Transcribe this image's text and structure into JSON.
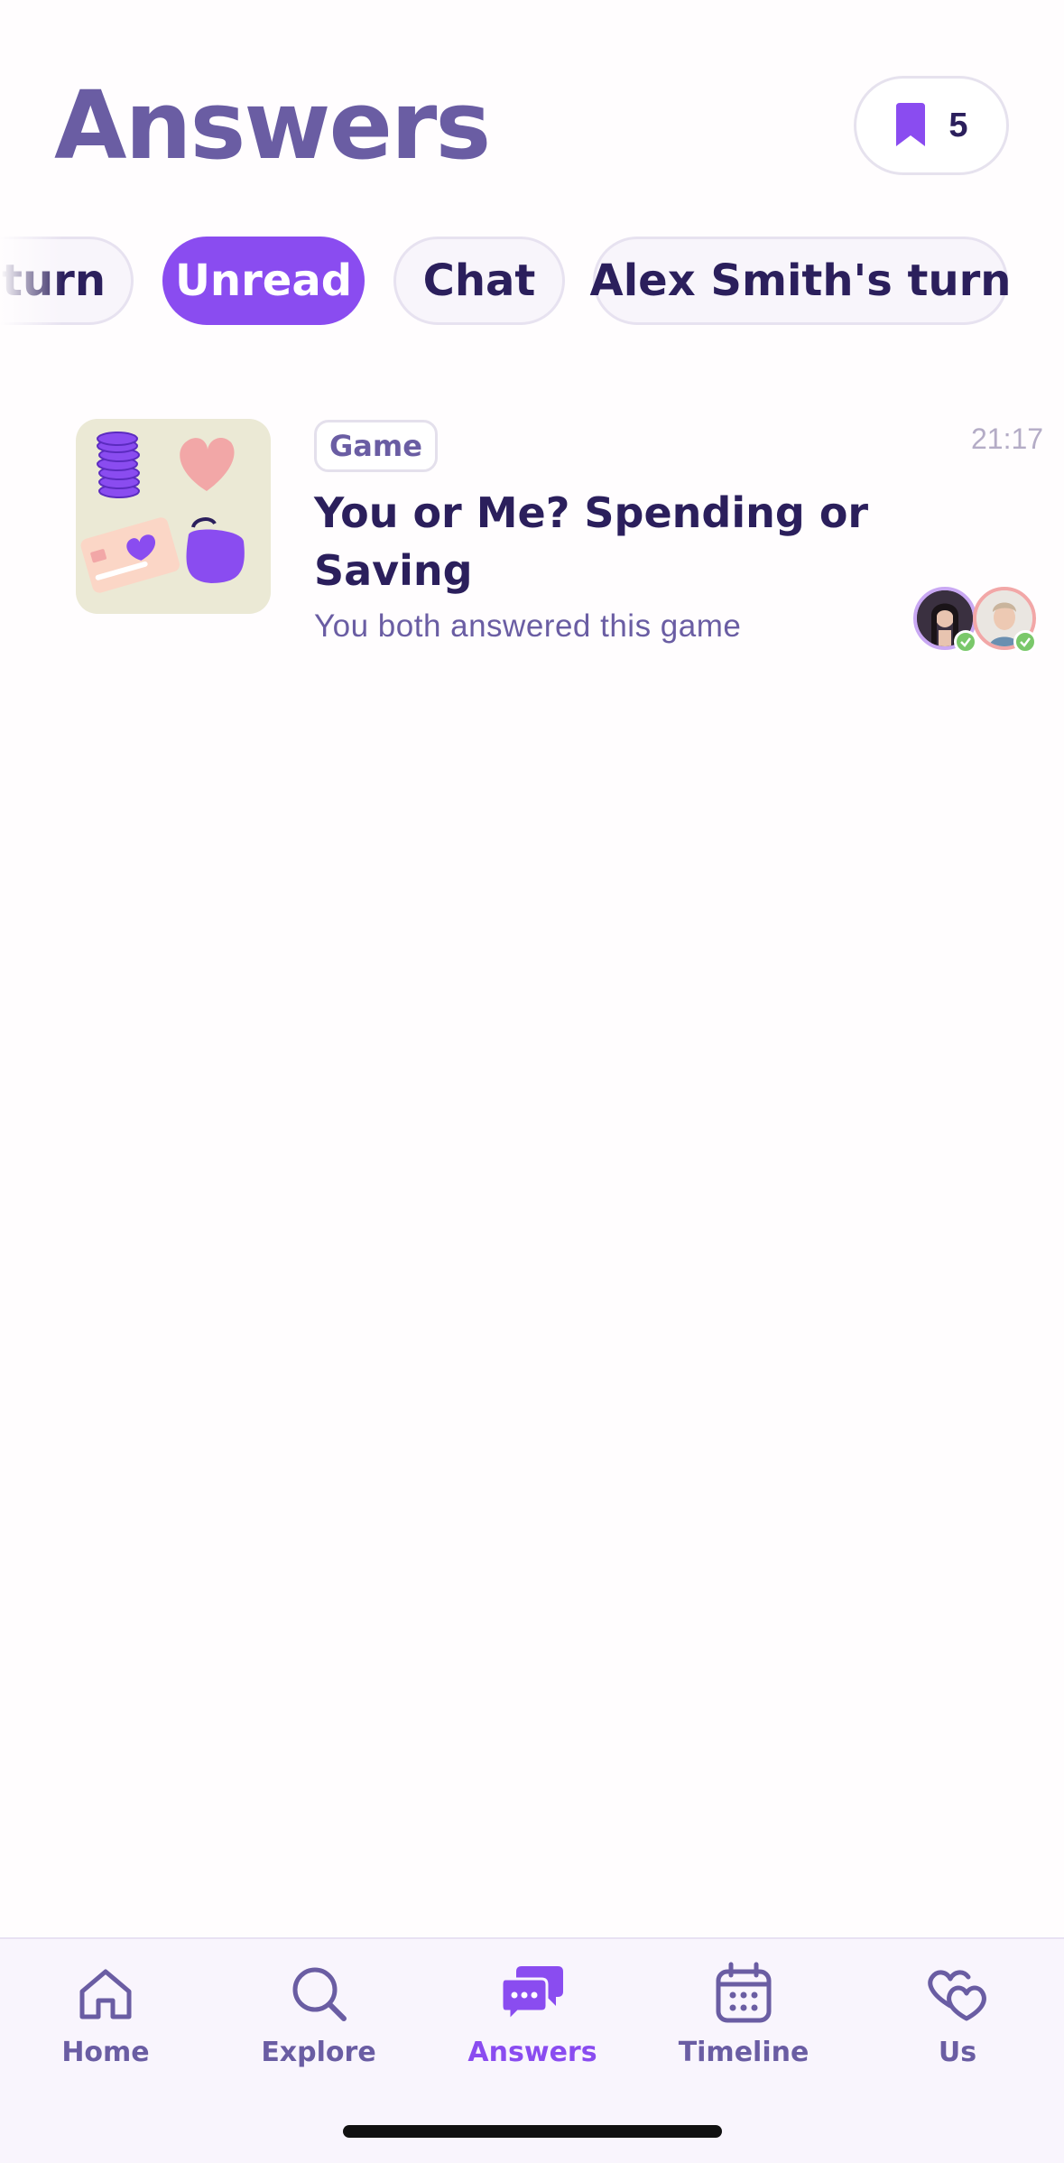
{
  "header": {
    "title": "Answers",
    "saved_count": "5"
  },
  "filters": {
    "partial_label": "turn",
    "unread_label": "Unread",
    "chat_label": "Chat",
    "partner_turn_label": "Alex Smith's turn"
  },
  "answer": {
    "type": "Game",
    "time": "21:17",
    "title": "You or Me? Spending or Saving",
    "subtitle": "You both answered this game"
  },
  "tabs": [
    {
      "label": "Home"
    },
    {
      "label": "Explore"
    },
    {
      "label": "Answers"
    },
    {
      "label": "Timeline"
    },
    {
      "label": "Us"
    }
  ],
  "colors": {
    "accent": "#8a4cf0",
    "heading": "#6a5da3",
    "text": "#2b1f5c",
    "check": "#7ac86a"
  },
  "active_tab": "Answers"
}
